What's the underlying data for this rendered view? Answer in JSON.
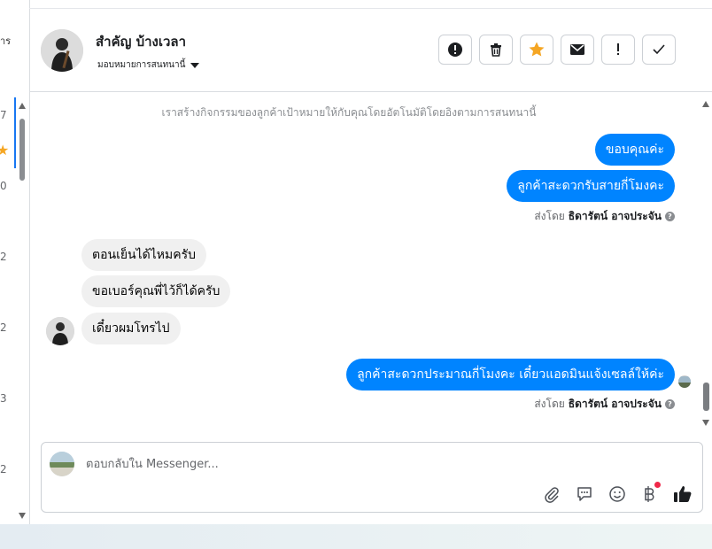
{
  "left_panel": {
    "partial_label": "าร",
    "numbers": [
      "7",
      "0",
      "2",
      "2",
      "3",
      "2"
    ]
  },
  "header": {
    "name": "สำคัญ บ้างเวลา",
    "assign_label": "มอบหมายการสนทนานี้",
    "actions": [
      {
        "name": "spam-button",
        "icon": "alert-circle-icon"
      },
      {
        "name": "delete-button",
        "icon": "trash-icon"
      },
      {
        "name": "star-button",
        "icon": "star-icon"
      },
      {
        "name": "mark-unread-button",
        "icon": "envelope-icon"
      },
      {
        "name": "follow-up-button",
        "icon": "exclamation-icon"
      },
      {
        "name": "mark-done-button",
        "icon": "check-icon"
      }
    ]
  },
  "chat": {
    "notice": "เราสร้างกิจกรรมของลูกค้าเป้าหมายให้กับคุณโดยอัตโนมัติโดยอิงตามการสนทนานี้",
    "messages": [
      {
        "side": "out",
        "text": "ขอบคุณค่ะ"
      },
      {
        "side": "out",
        "text": "ลูกค้าสะดวกรับสายกี่โมงคะ"
      },
      {
        "side": "in",
        "text": "ตอนเย็นได้ไหมครับ"
      },
      {
        "side": "in",
        "text": "ขอเบอร์คุณพี่ไว้ก็ได้ครับ"
      },
      {
        "side": "in",
        "text": "เดี๋ยวผมโทรไป"
      },
      {
        "side": "out",
        "text": "ลูกค้าสะดวกประมาณกี่โมงคะ เดี๋ยวแอดมินแจ้งเซลล์ให้ค่ะ"
      }
    ],
    "sent_by_prefix": "ส่งโดย",
    "sent_by_name": "ธิดารัตน์ อาจประจัน"
  },
  "composer": {
    "placeholder": "ตอบกลับใน Messenger..."
  },
  "colors": {
    "accent": "#0084ff",
    "star": "#f5a623",
    "notification_dot": "#f02849"
  }
}
